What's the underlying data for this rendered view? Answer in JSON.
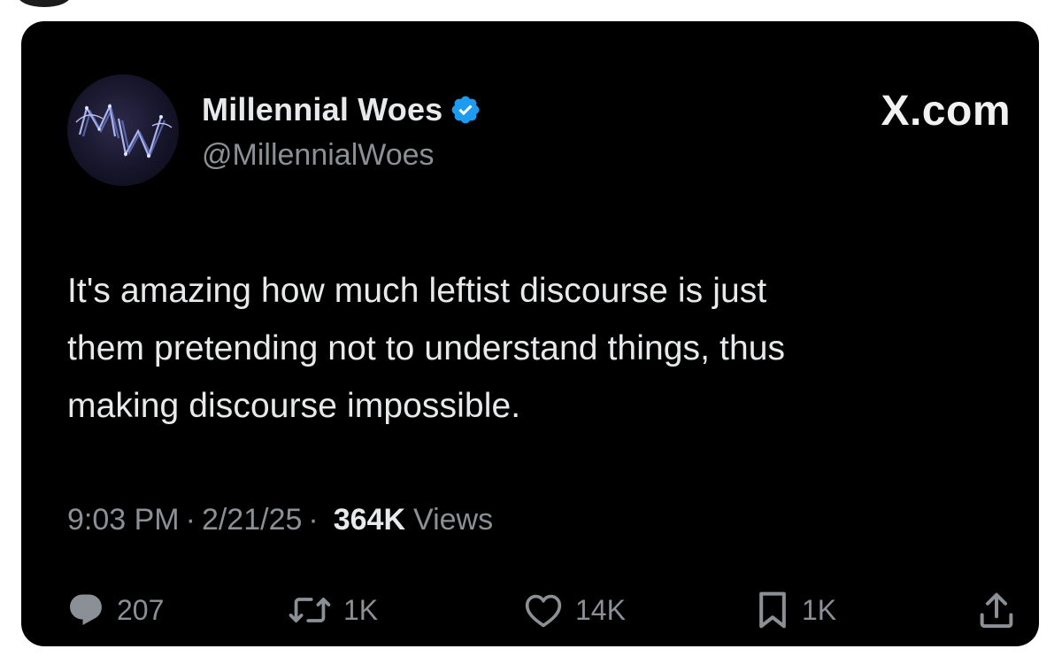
{
  "author": {
    "display_name": "Millennial Woes",
    "handle": "@MillennialWoes",
    "avatar_monogram": "MW",
    "verified_icon": "verified-badge-icon"
  },
  "brand": {
    "label": "X.com"
  },
  "tweet": {
    "lines": [
      "It's amazing how much leftist discourse is just",
      "them pretending not to understand things, thus",
      "making discourse impossible."
    ]
  },
  "meta": {
    "time": "9:03 PM",
    "separator": "·",
    "date": "2/21/25",
    "views_count": "364K",
    "views_label": "Views"
  },
  "actions": {
    "reply": {
      "icon": "reply-icon",
      "count": "207"
    },
    "repost": {
      "icon": "repost-icon",
      "count": "1K"
    },
    "like": {
      "icon": "heart-icon",
      "count": "14K"
    },
    "bookmark": {
      "icon": "bookmark-icon",
      "count": "1K"
    },
    "share": {
      "icon": "share-icon"
    }
  },
  "colors": {
    "background": "#000000",
    "primary_text": "#e7e9ea",
    "secondary_text": "#8b9096",
    "verified_blue": "#1d9bf0"
  }
}
